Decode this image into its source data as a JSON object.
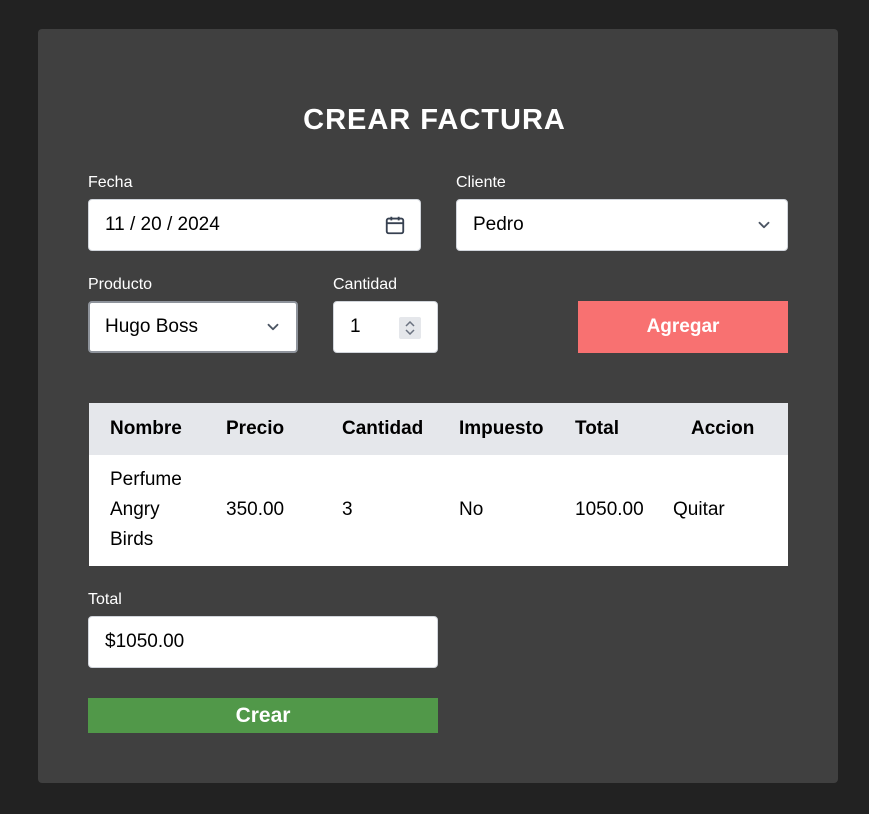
{
  "title": "CREAR FACTURA",
  "fecha": {
    "label": "Fecha",
    "value": "11 / 20 / 2024",
    "icon": "calendar-icon"
  },
  "cliente": {
    "label": "Cliente",
    "value": "Pedro",
    "icon": "chevron-down-icon"
  },
  "producto": {
    "label": "Producto",
    "value": "Hugo Boss",
    "icon": "chevron-down-icon"
  },
  "cantidad": {
    "label": "Cantidad",
    "value": "1"
  },
  "agregar_label": "Agregar",
  "table": {
    "headers": [
      "Nombre",
      "Precio",
      "Cantidad",
      "Impuesto",
      "Total",
      "Accion"
    ],
    "rows": [
      {
        "nombre": [
          "Perfume",
          "Angry",
          "Birds"
        ],
        "precio": "350.00",
        "cantidad": "3",
        "impuesto": "No",
        "total": "1050.00",
        "accion": "Quitar"
      }
    ]
  },
  "total": {
    "label": "Total",
    "value": "$1050.00"
  },
  "crear_label": "Crear",
  "colors": {
    "background": "#222222",
    "panel": "#404040",
    "add_button": "#f87171",
    "create_button": "#519849",
    "table_header": "#e5e7eb"
  }
}
